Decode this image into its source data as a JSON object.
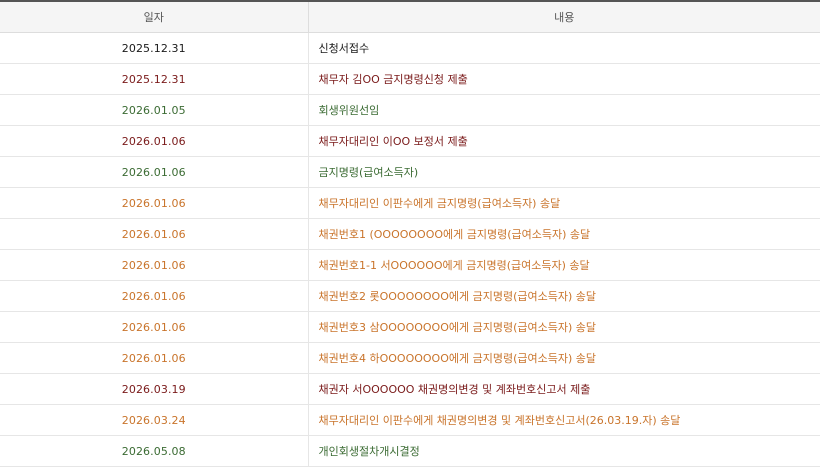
{
  "colors": {
    "black": "#1a1a1a",
    "red": "#7a1a1a",
    "green": "#3b6b33",
    "orange": "#c9742b"
  },
  "table": {
    "headers": {
      "date": "일자",
      "content": "내용"
    },
    "rows": [
      {
        "date": "2025.12.31",
        "content": "신청서접수",
        "color": "black"
      },
      {
        "date": "2025.12.31",
        "content": "채무자 김OO 금지명령신청 제출",
        "color": "red"
      },
      {
        "date": "2026.01.05",
        "content": "회생위원선임",
        "color": "green"
      },
      {
        "date": "2026.01.06",
        "content": "채무자대리인 이OO 보정서 제출",
        "color": "red"
      },
      {
        "date": "2026.01.06",
        "content": "금지명령(급여소득자)",
        "color": "green"
      },
      {
        "date": "2026.01.06",
        "content": "채무자대리인 이판수에게 금지명령(급여소득자) 송달",
        "color": "orange"
      },
      {
        "date": "2026.01.06",
        "content": "채권번호1 (OOOOOOOO에게 금지명령(급여소득자) 송달",
        "color": "orange"
      },
      {
        "date": "2026.01.06",
        "content": "채권번호1-1 서OOOOOO에게 금지명령(급여소득자) 송달",
        "color": "orange"
      },
      {
        "date": "2026.01.06",
        "content": "채권번호2 롯OOOOOOOO에게 금지명령(급여소득자) 송달",
        "color": "orange"
      },
      {
        "date": "2026.01.06",
        "content": "채권번호3 삼OOOOOOOO에게 금지명령(급여소득자) 송달",
        "color": "orange"
      },
      {
        "date": "2026.01.06",
        "content": "채권번호4 하OOOOOOOO에게 금지명령(급여소득자) 송달",
        "color": "orange"
      },
      {
        "date": "2026.03.19",
        "content": "채권자 서OOOOOO 채권명의변경 및 계좌번호신고서 제출",
        "color": "red"
      },
      {
        "date": "2026.03.24",
        "content": "채무자대리인 이판수에게 채권명의변경 및 계좌번호신고서(26.03.19.자) 송달",
        "color": "orange"
      },
      {
        "date": "2026.05.08",
        "content": "개인회생절차개시결정",
        "color": "green"
      }
    ]
  }
}
